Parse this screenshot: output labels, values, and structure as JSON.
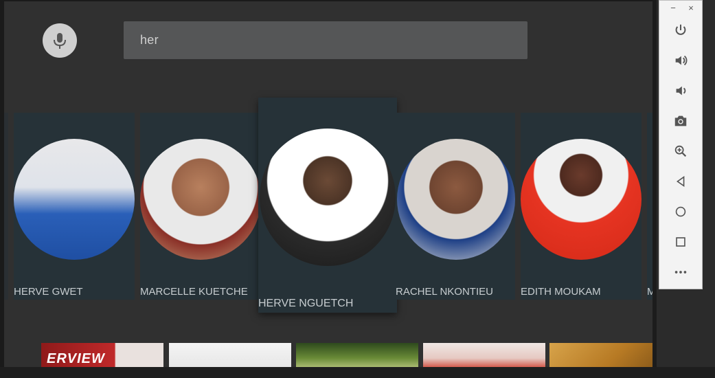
{
  "search": {
    "query": "her"
  },
  "cards": [
    {
      "name": "HERVE GWET"
    },
    {
      "name": "MARCELLE KUETCHE"
    },
    {
      "name": "HERVE NGUETCH"
    },
    {
      "name": "RACHEL NKONTIEU"
    },
    {
      "name": "EDITH MOUKAM"
    },
    {
      "name": "M"
    }
  ],
  "thumbnails": [
    {
      "text": "ERVIEW"
    }
  ],
  "toolbar": {
    "minimize": "−",
    "close": "×",
    "tools": [
      "power-icon",
      "volume-up-icon",
      "volume-down-icon",
      "camera-icon",
      "zoom-icon",
      "back-icon",
      "home-icon",
      "overview-icon",
      "more-icon"
    ]
  },
  "colors": {
    "screen_bg": "#303030",
    "card_bg": "#263238",
    "search_bg": "#555657",
    "card_text": "#c7cdd0"
  }
}
